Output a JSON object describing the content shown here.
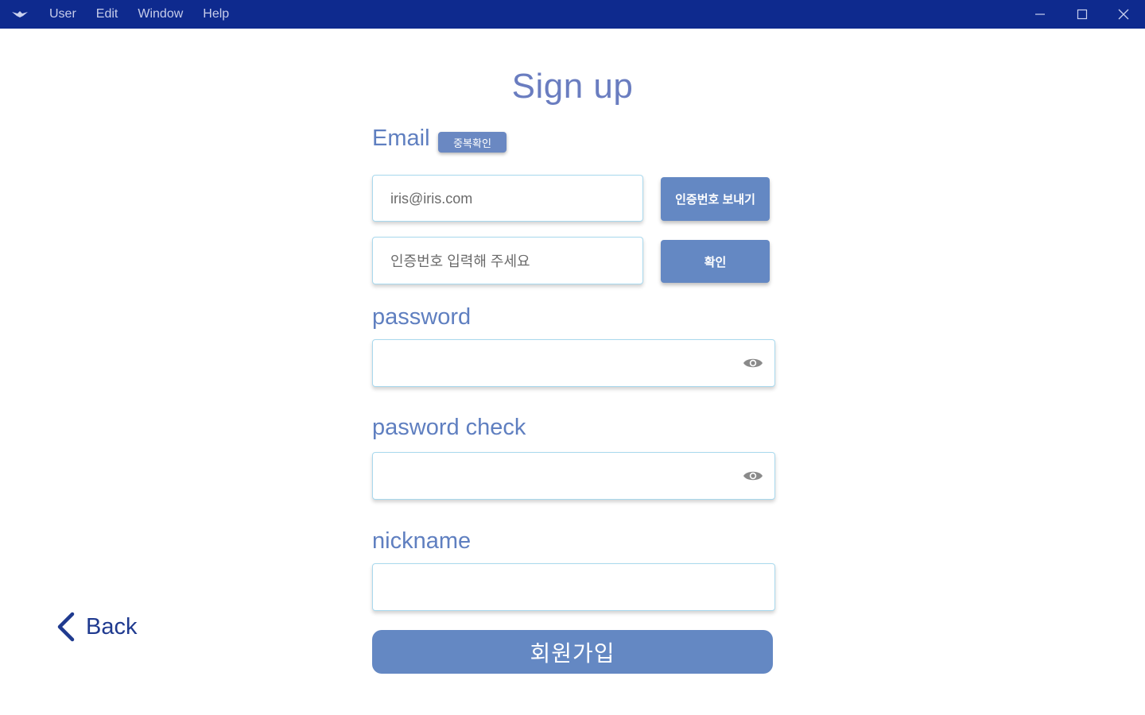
{
  "titlebar": {
    "menu": [
      "User",
      "Edit",
      "Window",
      "Help"
    ]
  },
  "page": {
    "title": "Sign up"
  },
  "email": {
    "label": "Email",
    "dup_check_label": "중복확인",
    "value": "",
    "placeholder": "iris@iris.com",
    "send_code_label": "인증번호 보내기"
  },
  "verification": {
    "placeholder": "인증번호 입력해 주세요",
    "confirm_label": "확인"
  },
  "password": {
    "label": "password",
    "value": ""
  },
  "password_check": {
    "label": "pasword check",
    "value": ""
  },
  "nickname": {
    "label": "nickname",
    "value": ""
  },
  "actions": {
    "submit_label": "회원가입",
    "back_label": "Back"
  },
  "colors": {
    "titlebar": "#0e2a8e",
    "accent": "#6488c3",
    "label": "#5f7fc0",
    "field_border": "#a9d9ee",
    "back": "#1f3a8f"
  },
  "icons": {
    "app": "app-logo-icon",
    "minimize": "minimize-icon",
    "maximize": "maximize-icon",
    "close": "close-icon",
    "eye": "eye-icon",
    "back": "chevron-left-icon"
  }
}
